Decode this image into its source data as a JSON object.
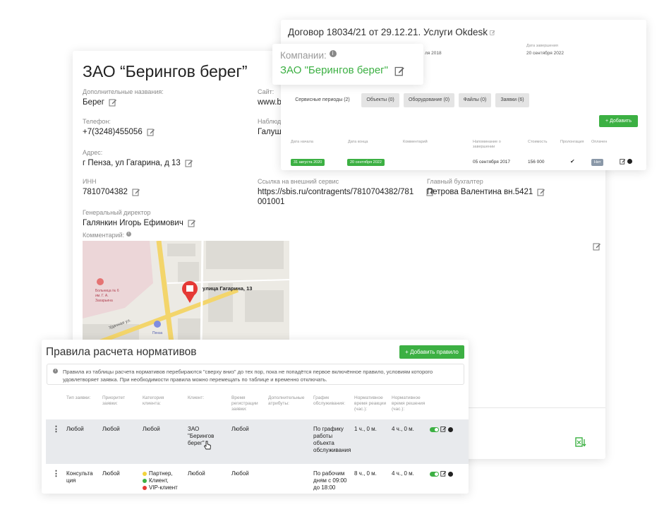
{
  "company": {
    "title": "ЗАО “Берингов берег”",
    "fields": {
      "alt_names_label": "Дополнительные названия:",
      "alt_names_value": "Берег",
      "site_label": "Сайт:",
      "site_value": "www.be",
      "phone_label": "Телефон:",
      "phone_value": "+7(3248)455056",
      "observers_label": "Наблюд",
      "observers_value": "Галушк",
      "address_label": "Адрес:",
      "address_value": "г Пенза, ул Гагарина, д 13",
      "inn_label": "ИНН",
      "inn_value": "7810704382",
      "ext_link_label": "Ссылка на внешний сервис",
      "ext_link_line1": "https://sbis.ru/contragents/7810704382/781",
      "ext_link_line2": "001001",
      "accountant_label": "Главный бухгалтер",
      "accountant_value": "Петрова Валентина вн.5421",
      "director_label": "Генеральный директор",
      "director_value": "Галянкин Игорь Ефимович",
      "comment_label": "Комментарий:"
    },
    "map": {
      "marker_label": "улица Гагарина, 13",
      "street_label": "Удачная ул.",
      "hospital_label_1": "Больница № 6",
      "hospital_label_2": "им. Г. А.",
      "hospital_label_3": "Захарьина",
      "shop_label": "Пенза"
    }
  },
  "contract": {
    "title": "Договор 18034/21 от 29.12.21. Услуги Okdesk",
    "hidden_meta": {
      "left_value": "ля 2018",
      "right_label": "Дата завершения",
      "right_value": "20 сентября 2022"
    },
    "tabs": [
      {
        "label": "Сервисные периоды (2)"
      },
      {
        "label": "Объекты (0)"
      },
      {
        "label": "Оборудование (0)"
      },
      {
        "label": "Файлы (0)"
      },
      {
        "label": "Заявки (6)"
      }
    ],
    "add_button": "Добавить",
    "columns": [
      "Дата начала",
      "Дата конца",
      "Комментарий",
      "Напоминание о завершении",
      "Стоимость",
      "Пролонгация",
      "Оплачен"
    ],
    "row": {
      "start": "31 августа 2020",
      "end": "20 сентября 2022",
      "reminder": "05 сентября 2017",
      "cost": "156 000",
      "paid": "Нет"
    }
  },
  "companies_popup": {
    "label": "Компании:",
    "value": "ЗАО \"Берингов берег\""
  },
  "rules": {
    "title": "Правила расчета нормативов",
    "add_button": "Добавить правило",
    "info_line1": "Правила из таблицы расчета нормативов перебираются \"сверху вниз\" до тех пор, пока не попадётся первое включённое правило, условиям которого",
    "info_line2": "удовлетворяет заявка. При необходимости правила можно перемещать по таблице и временно отключать.",
    "columns": [
      "Тип заявки:",
      "Приоритет заявки:",
      "Категория клиента:",
      "Клиент:",
      "Время регистрации заявки:",
      "Дополнительные атрибуты:",
      "График обслуживания:",
      "Нормативное время реакции (час.):",
      "Нормативное время решения (час.):"
    ],
    "rows": [
      {
        "type": "Любой",
        "priority": "Любой",
        "category": "Любой",
        "client": "ЗАО \"Берингов берег\"",
        "reg_time": "Любой",
        "schedule": "По графику работы объекта обслуживания",
        "reaction": "1 ч., 0 м.",
        "solution": "4 ч., 0 м."
      },
      {
        "type": "Консультация",
        "priority": "Любой",
        "categories": [
          "Партнер,",
          "Клиент,",
          "VIP-клиент"
        ],
        "client": "Любой",
        "reg_time": "Любой",
        "schedule": "По рабочим дням с 09:00 до 18:00",
        "reaction": "8 ч., 0 м.",
        "solution": "4 ч., 0 м."
      }
    ]
  },
  "colors": {
    "accent_green": "#3cb043",
    "map_marker": "#e53935",
    "road": "#f3d56b",
    "dot_yellow": "#f2d43c",
    "dot_green": "#3cb043",
    "dot_red": "#e53935"
  }
}
